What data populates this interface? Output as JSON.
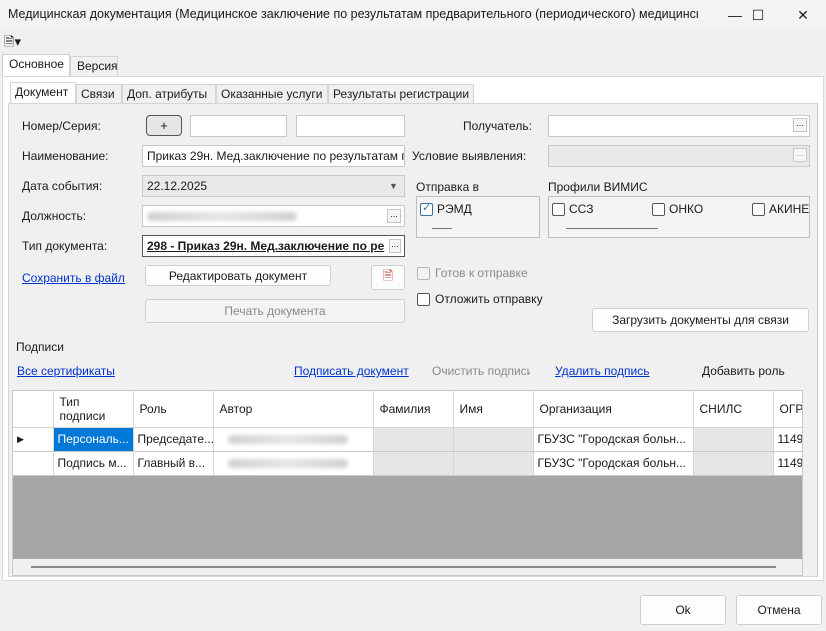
{
  "window": {
    "title": "Медицинская документация (Медицинское заключение по результатам предварительного (периодического) медицинск...",
    "minimize": "—",
    "maximize": "☐",
    "close": "✕"
  },
  "toolbar": {
    "icon": "document-menu-icon",
    "glyph": "🗎▾"
  },
  "outer_tabs": [
    {
      "label": "Основное"
    },
    {
      "label": "Версия"
    }
  ],
  "inner_tabs": [
    {
      "label": "Документ"
    },
    {
      "label": "Связи"
    },
    {
      "label": "Доп. атрибуты"
    },
    {
      "label": "Оказанные услуги"
    },
    {
      "label": "Результаты регистрации"
    }
  ],
  "form": {
    "number_label": "Номер/Серия:",
    "plus_label": "+",
    "name_label": "Наименование:",
    "name_value": "Приказ 29н. Мед.заключение по результатам п",
    "date_label": "Дата события:",
    "date_value": "22.12.2025",
    "position_label": "Должность:",
    "doctype_label": "Тип документа:",
    "doctype_value": "298 - Приказ 29н. Мед.заключение по ре",
    "save_link": "Сохранить в файл",
    "edit_button": "Редактировать документ",
    "print_button": "Печать документа",
    "recipient_label": "Получатель:",
    "condition_label": "Условие выявления:",
    "send_label": "Отправка в",
    "remd_label": "РЭМД",
    "vimis_label": "Профили ВИМИС",
    "vimis_options": [
      "ССЗ",
      "ОНКО",
      "АКИНЕ"
    ],
    "ready_label": "Готов к отправке",
    "postpone_label": "Отложить отправку",
    "load_docs_button": "Загрузить документы для связи",
    "ellipsis": "..."
  },
  "signatures": {
    "section_label": "Подписи",
    "all_certs": "Все сертификаты",
    "sign_doc": "Подписать документ",
    "clear_sign": "Очистить подписи",
    "delete_sign": "Удалить подпись",
    "add_role": "Добавить роль",
    "columns": [
      "Тип подписи",
      "Роль",
      "Автор",
      "Фамилия",
      "Имя",
      "Организация",
      "СНИЛС",
      "ОГРН"
    ],
    "rows": [
      {
        "marker": "▶",
        "type": "Персональ...",
        "role": "Председате...",
        "org": "ГБУЗС \"Городская больн...",
        "ogrn": "11492"
      },
      {
        "marker": "",
        "type": "Подпись м...",
        "role": "Главный в...",
        "org": "ГБУЗС \"Городская больн...",
        "ogrn": "11492"
      }
    ]
  },
  "footer": {
    "ok": "Ok",
    "cancel": "Отмена"
  },
  "colors": {
    "selection": "#0078d7",
    "link": "#0033cc",
    "grid_empty": "#a6a6a6"
  }
}
